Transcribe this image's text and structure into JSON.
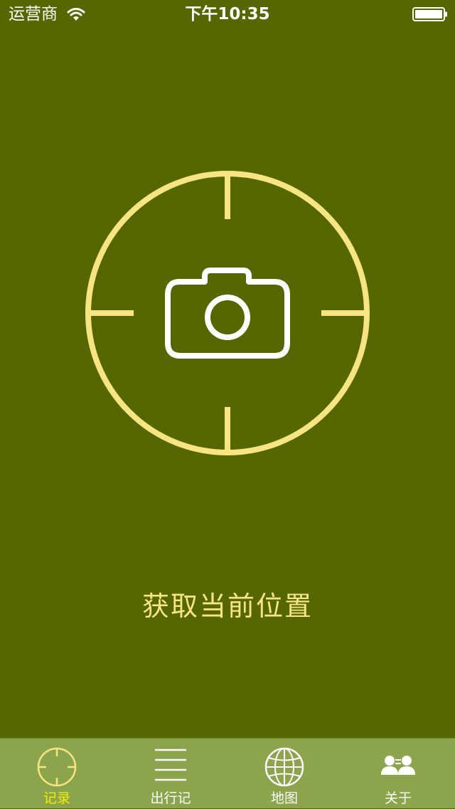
{
  "status_bar": {
    "carrier": "运营商",
    "time": "下午10:35",
    "wifi_icon": "wifi-icon",
    "battery_icon": "battery-full-icon",
    "battery_level": 1.0
  },
  "main": {
    "button_icon": "camera-crosshair-icon",
    "action_label": "获取当前位置"
  },
  "tab_bar": {
    "active_index": 0,
    "tabs": [
      {
        "label": "记录",
        "icon": "crosshair-icon"
      },
      {
        "label": "出行记",
        "icon": "list-icon"
      },
      {
        "label": "地图",
        "icon": "globe-icon"
      },
      {
        "label": "关于",
        "icon": "people-icon"
      }
    ]
  },
  "colors": {
    "background": "#566600",
    "accent": "#f7e582",
    "tab_bar_bg": "#8ca44b",
    "tab_active": "#f4f000",
    "tab_inactive": "#ffffff"
  }
}
